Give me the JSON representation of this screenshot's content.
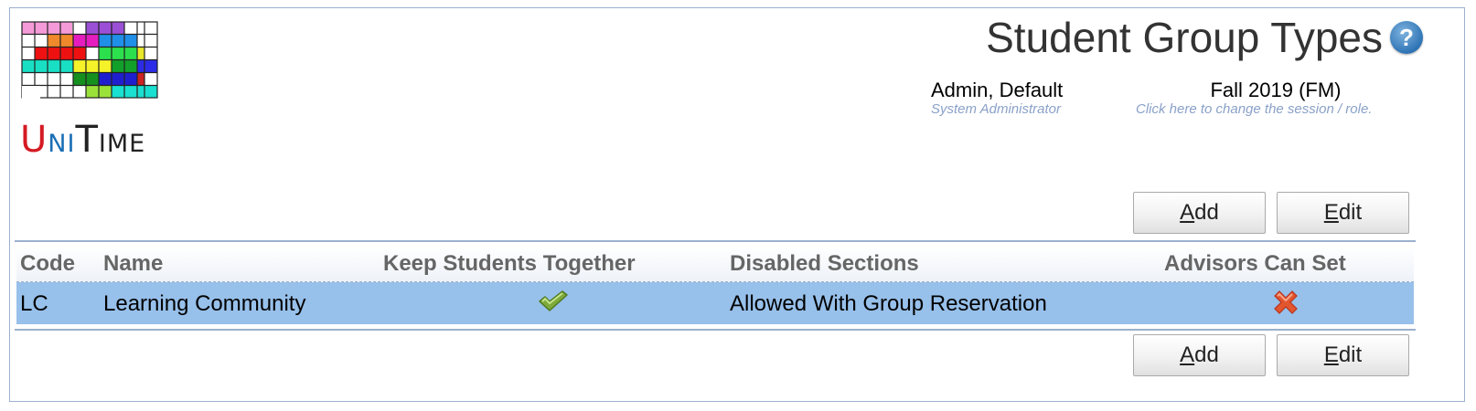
{
  "logo": {
    "word_parts": [
      "U",
      "NI",
      "T",
      "IME"
    ],
    "colors": [
      "#e8262a",
      "#1a6fb5",
      "#1aa24a",
      "#222222"
    ]
  },
  "header": {
    "title": "Student Group Types",
    "help_icon": "question-mark-icon"
  },
  "user": {
    "name": "Admin, Default",
    "role": "System Administrator"
  },
  "session": {
    "name": "Fall 2019 (FM)",
    "hint": "Click here to change the session / role."
  },
  "buttons": {
    "add": {
      "accel": "A",
      "rest": "dd"
    },
    "edit": {
      "accel": "E",
      "rest": "dit"
    }
  },
  "table": {
    "columns": [
      "Code",
      "Name",
      "Keep Students Together",
      "Disabled Sections",
      "Advisors Can Set"
    ],
    "rows": [
      {
        "code": "LC",
        "name": "Learning Community",
        "keep_together": "check-icon",
        "disabled_sections": "Allowed With Group Reservation",
        "advisors_can_set": "cross-icon"
      }
    ]
  },
  "colors": {
    "selected_row": "#97c0ea",
    "border": "#9cb0ce",
    "header_text": "#666666"
  }
}
